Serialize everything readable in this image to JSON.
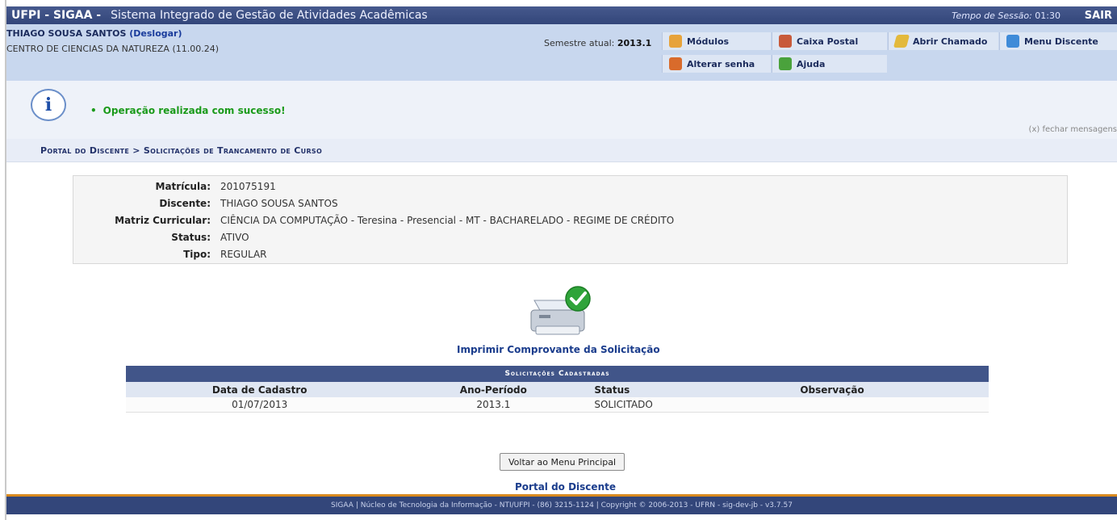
{
  "topbar": {
    "brand": "UFPI - SIGAA -",
    "system_name": "Sistema Integrado de Gestão de Atividades Acadêmicas",
    "session_label": "Tempo de Sessão:",
    "session_time": "01:30",
    "logout": "SAIR"
  },
  "user": {
    "name": "THIAGO SOUSA SANTOS",
    "deslogar": "(Deslogar)",
    "centro": "CENTRO DE CIENCIAS DA NATUREZA (11.00.24)",
    "semestre_label": "Semestre atual:",
    "semestre_value": "2013.1"
  },
  "menu": {
    "modulos": "Módulos",
    "caixa_postal": "Caixa Postal",
    "abrir_chamado": "Abrir Chamado",
    "menu_discente": "Menu Discente",
    "alterar_senha": "Alterar senha",
    "ajuda": "Ajuda"
  },
  "message": {
    "icon": "info-icon",
    "text": "Operação realizada com sucesso!",
    "close": "(x) fechar mensagens"
  },
  "breadcrumb": "Portal do Discente > Solicitações de Trancamento de Curso",
  "student": {
    "fields": [
      {
        "label": "Matrícula:",
        "value": "201075191"
      },
      {
        "label": "Discente:",
        "value": "THIAGO SOUSA SANTOS"
      },
      {
        "label": "Matriz Curricular:",
        "value": "CIÊNCIA DA COMPUTAÇÃO - Teresina - Presencial - MT - BACHARELADO - REGIME DE CRÉDITO"
      },
      {
        "label": "Status:",
        "value": "ATIVO"
      },
      {
        "label": "Tipo:",
        "value": "REGULAR"
      }
    ]
  },
  "print_link": "Imprimir Comprovante da Solicitação",
  "table": {
    "caption": "Solicitações Cadastradas",
    "headers": [
      "Data de Cadastro",
      "Ano-Período",
      "Status",
      "Observação"
    ],
    "rows": [
      [
        "01/07/2013",
        "2013.1",
        "SOLICITADO",
        ""
      ]
    ]
  },
  "buttons": {
    "voltar": "Voltar ao Menu Principal"
  },
  "portal_link": "Portal do Discente",
  "footer": "SIGAA | Núcleo de Tecnologia da Informação - NTI/UFPI - (86) 3215-1124 | Copyright © 2006-2013 - UFRN - sig-dev-jb - v3.7.57",
  "colors": {
    "header": "#33467a",
    "info": "#c8d7ee",
    "success": "#1a9a1a",
    "accent": "#d88a1f"
  }
}
